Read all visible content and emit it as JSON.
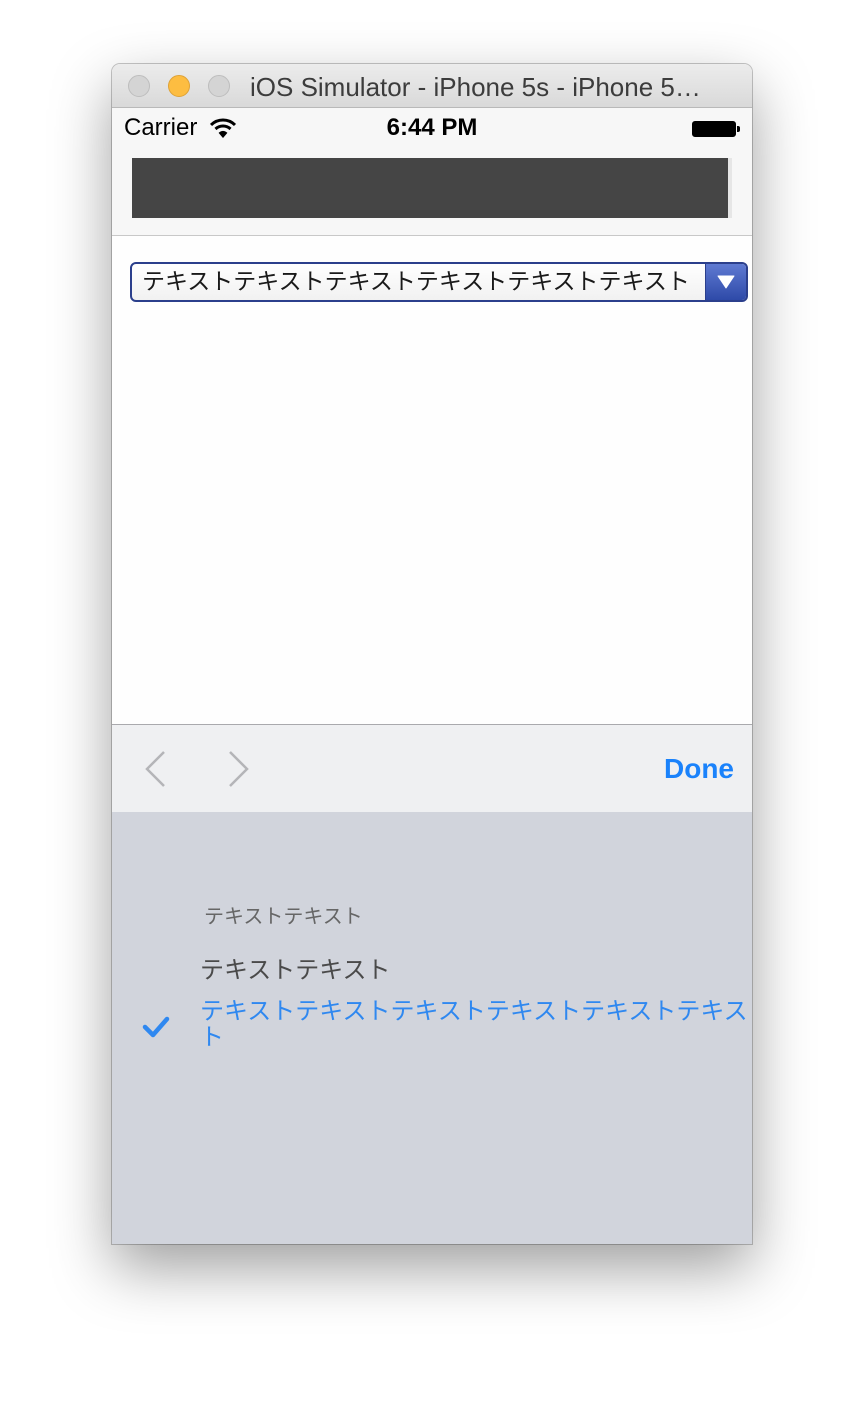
{
  "window": {
    "title": "iOS Simulator - iPhone 5s - iPhone 5…"
  },
  "statusbar": {
    "carrier": "Carrier",
    "time": "6:44 PM"
  },
  "select": {
    "value": "テキストテキストテキストテキストテキストテキスト"
  },
  "accessory": {
    "done_label": "Done"
  },
  "picker": {
    "options": [
      "テキストテキスト",
      "テキストテキスト",
      "テキストテキストテキストテキストテキストテキスト"
    ],
    "selected_index": 2
  },
  "colors": {
    "accent": "#1a82fb",
    "select_border": "#2b3f8c",
    "picker_background": "#d1d4dc"
  }
}
